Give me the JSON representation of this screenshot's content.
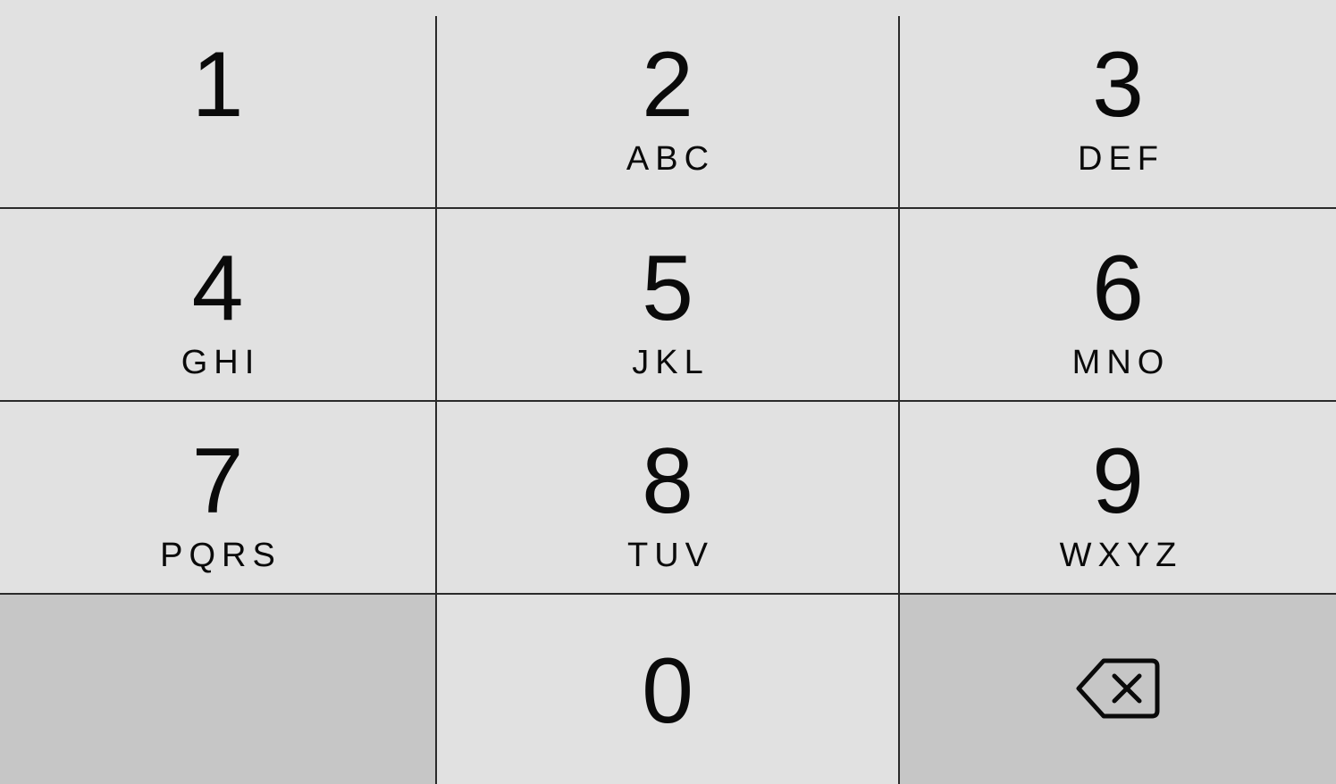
{
  "keypad": {
    "keys": [
      {
        "digit": "1",
        "letters": ""
      },
      {
        "digit": "2",
        "letters": "ABC"
      },
      {
        "digit": "3",
        "letters": "DEF"
      },
      {
        "digit": "4",
        "letters": "GHI"
      },
      {
        "digit": "5",
        "letters": "JKL"
      },
      {
        "digit": "6",
        "letters": "MNO"
      },
      {
        "digit": "7",
        "letters": "PQRS"
      },
      {
        "digit": "8",
        "letters": "TUV"
      },
      {
        "digit": "9",
        "letters": "WXYZ"
      },
      {
        "digit": "0",
        "letters": ""
      }
    ],
    "backspace_icon": "backspace-icon",
    "colors": {
      "key_background": "#e1e1e1",
      "function_key_background": "#c6c6c6",
      "divider": "#2a2a2a",
      "text": "#0a0a0a"
    }
  }
}
